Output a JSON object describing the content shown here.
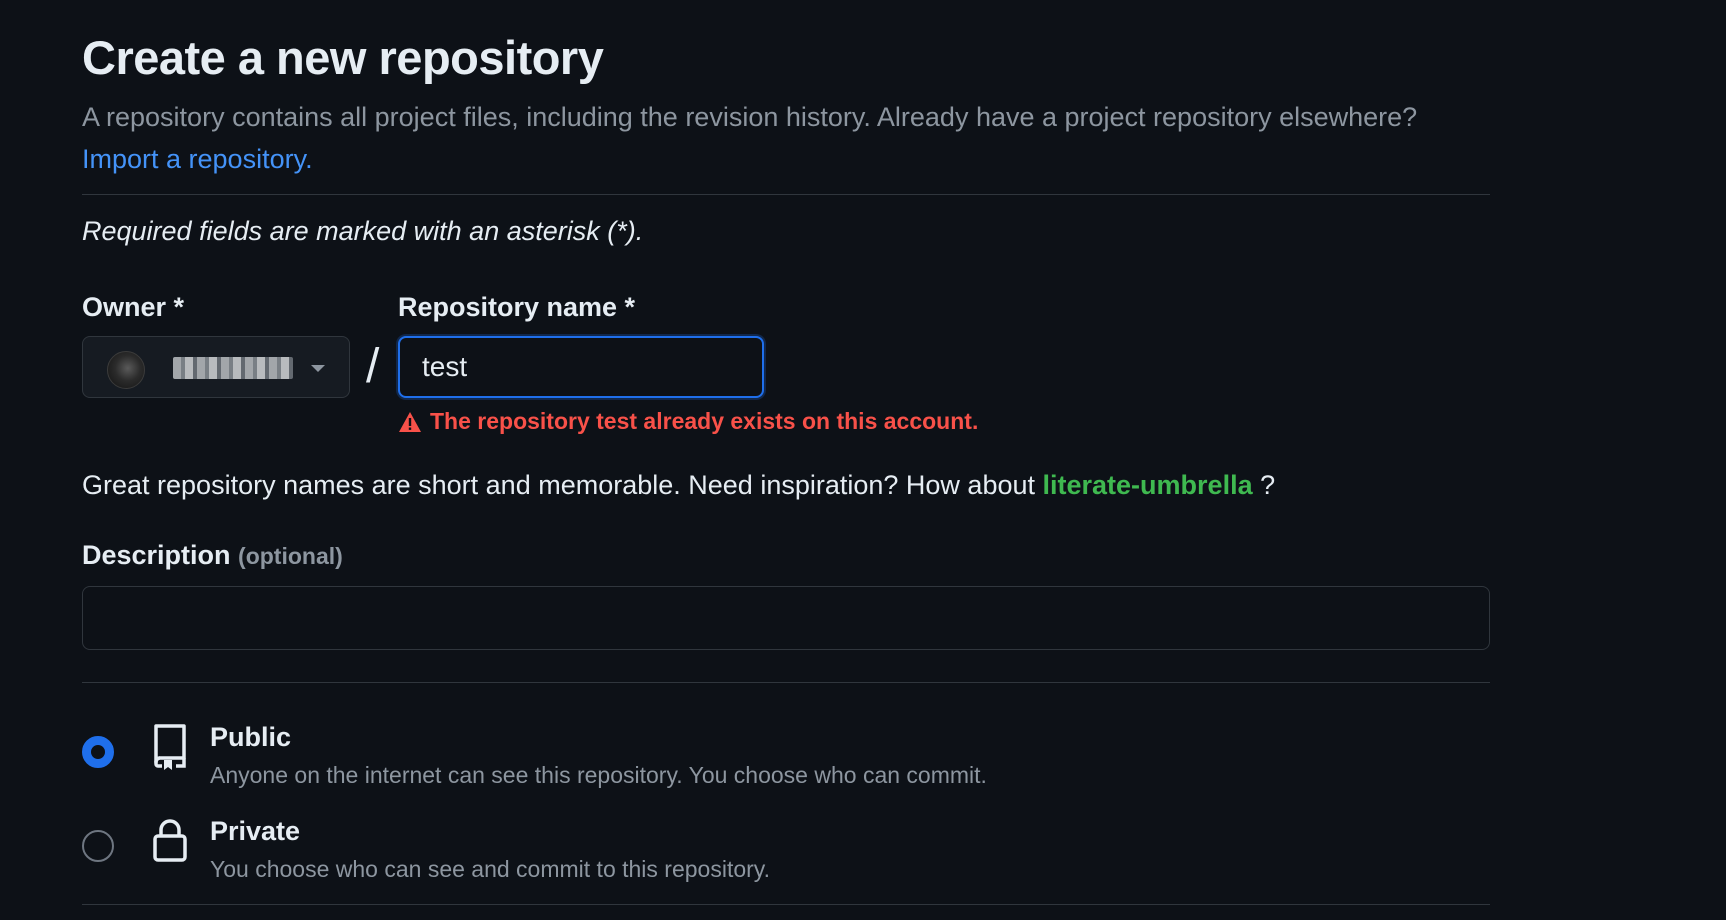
{
  "page": {
    "title": "Create a new repository",
    "intro_text": "A repository contains all project files, including the revision history. Already have a project repository elsewhere?",
    "import_link": "Import a repository.",
    "required_note": "Required fields are marked with an asterisk (*)."
  },
  "owner": {
    "label": "Owner *",
    "icon": "chevron-down-icon"
  },
  "separator": "/",
  "repo_name": {
    "label": "Repository name *",
    "value": "test",
    "error": "The repository test already exists on this account.",
    "error_icon": "alert-icon"
  },
  "hint": {
    "text": "Great repository names are short and memorable. Need inspiration? How about",
    "suggestion": "literate-umbrella",
    "suffix": "?"
  },
  "description": {
    "label": "Description",
    "optional": "(optional)",
    "value": ""
  },
  "visibility": {
    "selected": "Public",
    "options": [
      {
        "title": "Public",
        "desc": "Anyone on the internet can see this repository. You choose who can commit.",
        "icon": "repo-icon"
      },
      {
        "title": "Private",
        "desc": "You choose who can see and commit to this repository.",
        "icon": "lock-icon"
      }
    ]
  },
  "colors": {
    "background": "#0d1117",
    "text": "#e6edf3",
    "muted": "#8d96a0",
    "link": "#4493f8",
    "error": "#f85149",
    "success": "#3fb950",
    "accent": "#1f6feb",
    "border": "#30363d"
  }
}
